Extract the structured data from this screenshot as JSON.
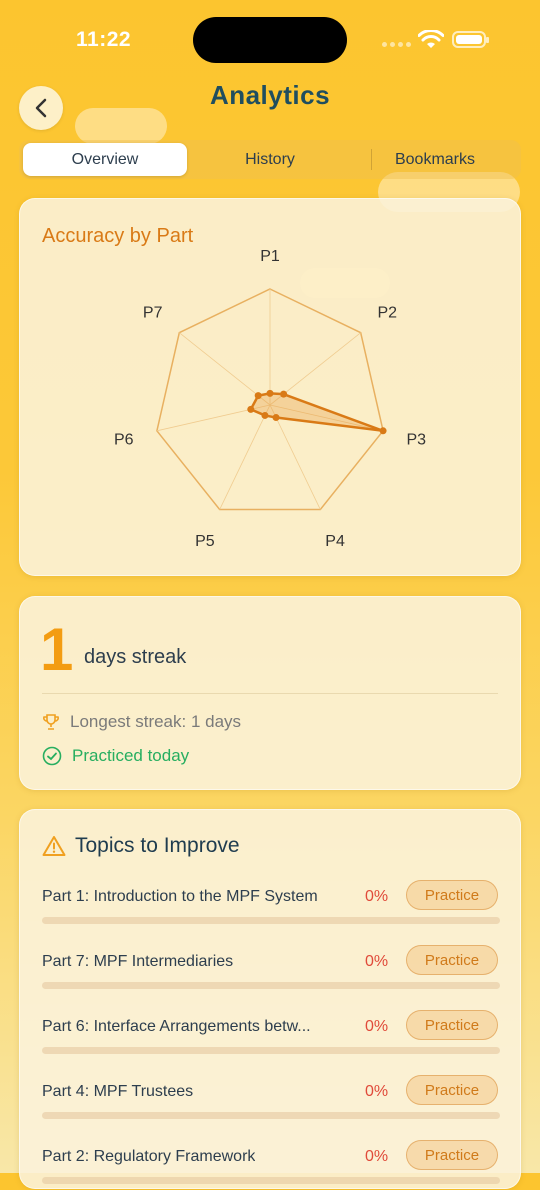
{
  "status": {
    "time": "11:22"
  },
  "header": {
    "title": "Analytics"
  },
  "tabs": [
    {
      "label": "Overview",
      "active": true
    },
    {
      "label": "History",
      "active": false
    },
    {
      "label": "Bookmarks",
      "active": false
    }
  ],
  "accuracy": {
    "title": "Accuracy by Part",
    "axes": [
      "P1",
      "P2",
      "P3",
      "P4",
      "P5",
      "P6",
      "P7"
    ],
    "values": [
      0.1,
      0.15,
      1.0,
      0.12,
      0.1,
      0.17,
      0.13
    ],
    "color": "#d97a16"
  },
  "streak": {
    "count": "1",
    "label": "days streak",
    "longest": "Longest streak: 1 days",
    "practiced": "Practiced today"
  },
  "topics": {
    "title": "Topics to Improve",
    "items": [
      {
        "name": "Part 1: Introduction to the MPF System",
        "percent": "0%",
        "button": "Practice"
      },
      {
        "name": "Part 7: MPF Intermediaries",
        "percent": "0%",
        "button": "Practice"
      },
      {
        "name": "Part 6: Interface Arrangements betw...",
        "percent": "0%",
        "button": "Practice"
      },
      {
        "name": "Part 4: MPF Trustees",
        "percent": "0%",
        "button": "Practice"
      },
      {
        "name": "Part 2: Regulatory Framework",
        "percent": "0%",
        "button": "Practice"
      }
    ]
  },
  "colors": {
    "accent": "#f39c12",
    "title": "#1f4e5f",
    "danger": "#e04a3a",
    "success": "#27ae60"
  }
}
